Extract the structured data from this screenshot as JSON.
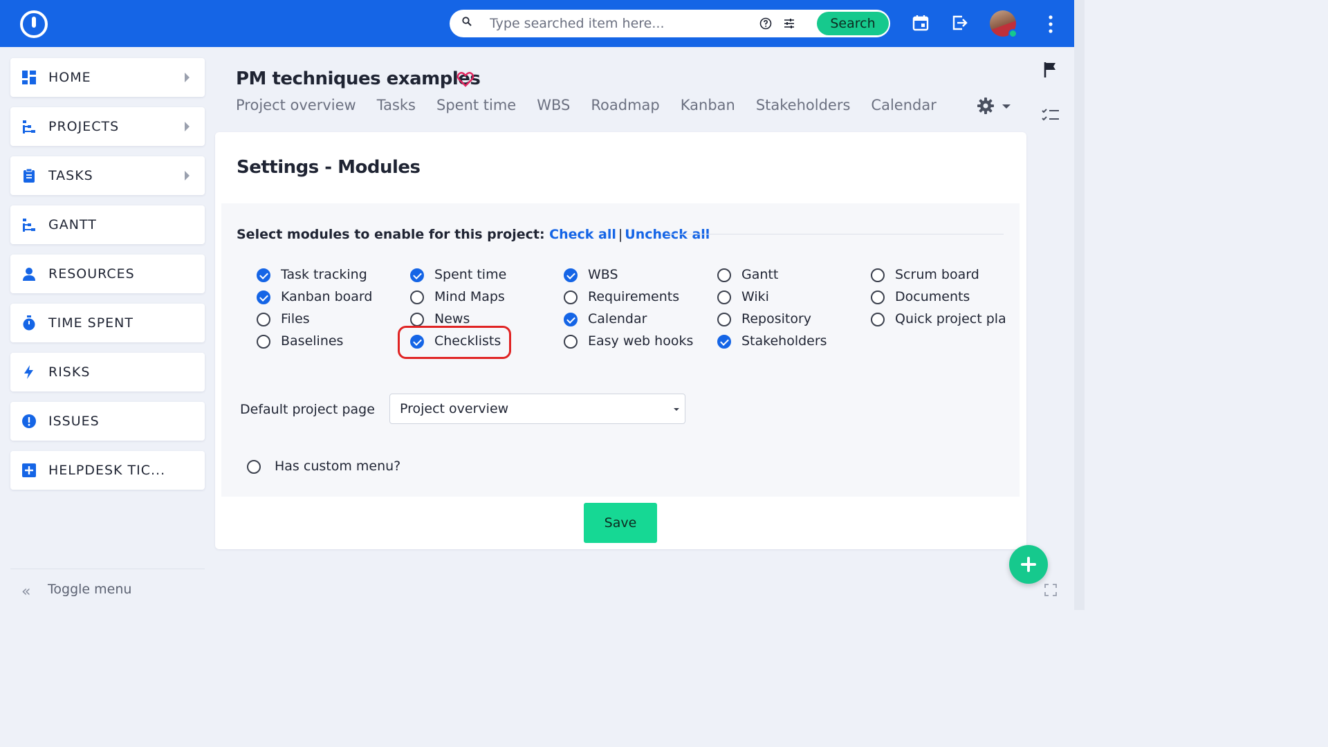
{
  "search": {
    "placeholder": "Type searched item here...",
    "button_label": "Search"
  },
  "sidebar": {
    "items": [
      {
        "label": "HOME",
        "icon": "dashboard-icon"
      },
      {
        "label": "PROJECTS",
        "icon": "projects-icon"
      },
      {
        "label": "TASKS",
        "icon": "clipboard-icon"
      },
      {
        "label": "GANTT",
        "icon": "gantt-icon"
      },
      {
        "label": "RESOURCES",
        "icon": "person-icon"
      },
      {
        "label": "TIME SPENT",
        "icon": "stopwatch-icon"
      },
      {
        "label": "RISKS",
        "icon": "lightning-icon"
      },
      {
        "label": "ISSUES",
        "icon": "alert-icon"
      },
      {
        "label": "HELPDESK TIC...",
        "icon": "plus-box-icon"
      }
    ],
    "toggle_label": "Toggle menu"
  },
  "project": {
    "title": "PM techniques examples",
    "tabs": [
      "Project overview",
      "Tasks",
      "Spent time",
      "WBS",
      "Roadmap",
      "Kanban",
      "Stakeholders",
      "Calendar"
    ]
  },
  "settings": {
    "title": "Settings - Modules",
    "select_prompt": "Select modules to enable for this project:",
    "check_all": "Check all",
    "uncheck_all": "Uncheck all",
    "modules": [
      {
        "label": "Task tracking",
        "checked": true
      },
      {
        "label": "Kanban board",
        "checked": true
      },
      {
        "label": "Files",
        "checked": false
      },
      {
        "label": "Baselines",
        "checked": false
      },
      {
        "label": "Spent time",
        "checked": true
      },
      {
        "label": "Mind Maps",
        "checked": false
      },
      {
        "label": "News",
        "checked": false
      },
      {
        "label": "Checklists",
        "checked": true
      },
      {
        "label": "WBS",
        "checked": true
      },
      {
        "label": "Requirements",
        "checked": false
      },
      {
        "label": "Calendar",
        "checked": true
      },
      {
        "label": "Easy web hooks",
        "checked": false
      },
      {
        "label": "Gantt",
        "checked": false
      },
      {
        "label": "Wiki",
        "checked": false
      },
      {
        "label": "Repository",
        "checked": false
      },
      {
        "label": "Stakeholders",
        "checked": true
      },
      {
        "label": "Scrum board",
        "checked": false
      },
      {
        "label": "Documents",
        "checked": false
      },
      {
        "label": "Quick project plar",
        "checked": false
      }
    ],
    "default_page_label": "Default project page",
    "default_page_value": "Project overview",
    "custom_menu_label": "Has custom menu?",
    "custom_menu_checked": false,
    "save_label": "Save"
  },
  "colors": {
    "brand_blue": "#1565e6",
    "accent_green": "#16c98d",
    "highlight_red": "#e02323"
  }
}
